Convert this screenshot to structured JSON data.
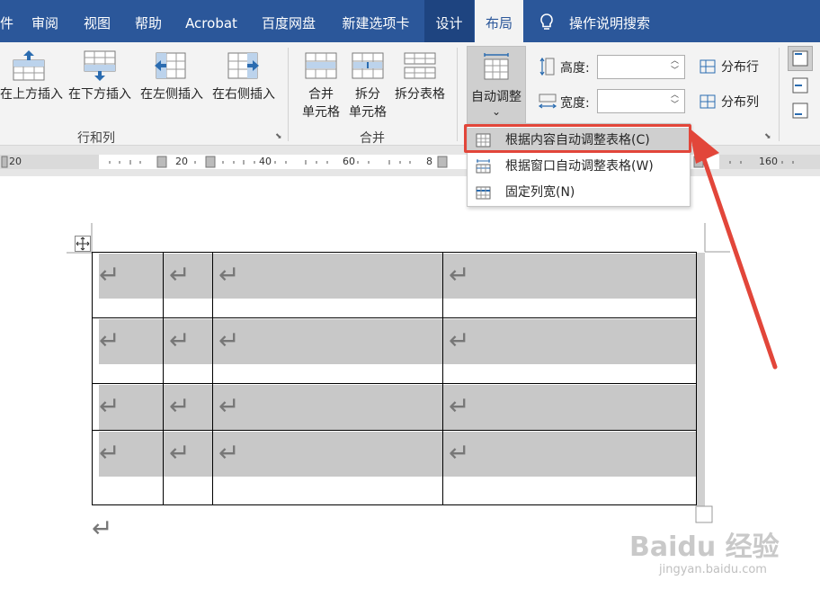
{
  "tabs": [
    {
      "label": "件"
    },
    {
      "label": "审阅"
    },
    {
      "label": "视图"
    },
    {
      "label": "帮助"
    },
    {
      "label": "Acrobat"
    },
    {
      "label": "百度网盘"
    },
    {
      "label": "新建选项卡"
    },
    {
      "label": "设计"
    },
    {
      "label": "布局"
    },
    {
      "label": "操作说明搜索"
    }
  ],
  "ribbon": {
    "rows_cols": {
      "insert_above": "在上方插入",
      "insert_below": "在下方插入",
      "insert_left": "在左侧插入",
      "insert_right": "在右侧插入",
      "group_label": "行和列"
    },
    "merge": {
      "merge_cells_1": "合并",
      "merge_cells_2": "单元格",
      "split_cells_1": "拆分",
      "split_cells_2": "单元格",
      "split_table": "拆分表格",
      "group_label": "合并"
    },
    "cell_size": {
      "autofit": "自动调整",
      "autofit_caret": "⌄",
      "height_label": "高度:",
      "width_label": "宽度:",
      "height_value": "",
      "width_value": "",
      "distribute_rows": "分布行",
      "distribute_cols": "分布列"
    }
  },
  "ruler": {
    "labels": [
      "20",
      "20",
      "40",
      "60",
      "8",
      "160"
    ]
  },
  "dropdown": {
    "items": [
      {
        "label": "根据内容自动调整表格(C)",
        "selected": true
      },
      {
        "label": "根据窗口自动调整表格(W)",
        "selected": false
      },
      {
        "label": "固定列宽(N)",
        "selected": false
      }
    ]
  },
  "document": {
    "paragraph_mark": "↵",
    "table_rows": 4,
    "table_cols": 4
  },
  "watermark": {
    "text": "Baidu 经验",
    "sub": "jingyan.baidu.com"
  },
  "colors": {
    "tabbar": "#2b579a",
    "ribbon": "#f3f3f3",
    "cell_shading": "#c8c8c8",
    "highlight": "#e2463a"
  }
}
